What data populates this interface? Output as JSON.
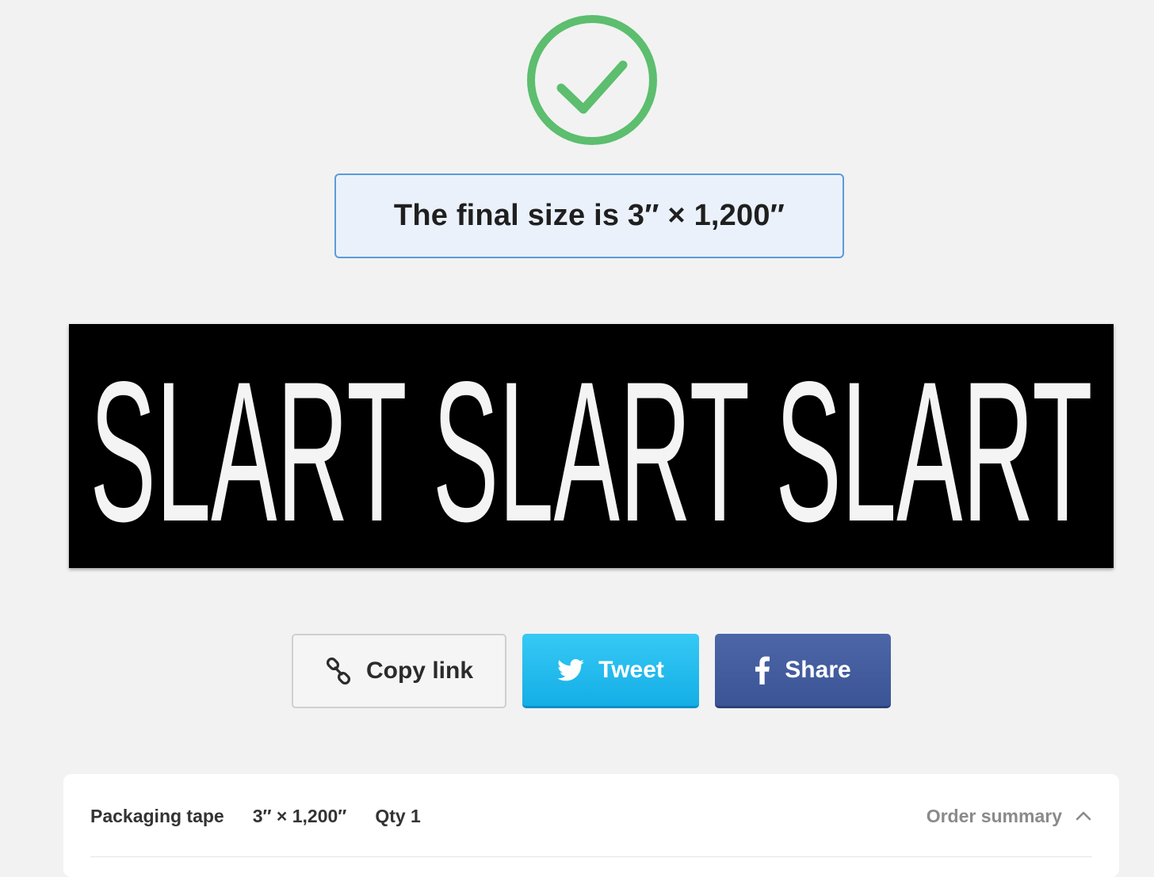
{
  "status": {
    "icon": "check-circle-icon",
    "color": "#5cbe6e"
  },
  "banner": {
    "text": "The final size is 3″ × 1,200″",
    "border_color": "#5b9bd9",
    "background": "#eaf1fb"
  },
  "preview": {
    "text": "SLART SLART SLART",
    "background": "#000000",
    "text_color": "#f4f4f4"
  },
  "share": {
    "copy_label": "Copy link",
    "copy_icon": "link-icon",
    "tweet_label": "Tweet",
    "tweet_icon": "twitter-bird-icon",
    "tweet_color": "#1fb8ec",
    "share_label": "Share",
    "share_icon": "facebook-icon",
    "share_color": "#435ea0"
  },
  "order": {
    "product": "Packaging tape",
    "size": "3″ × 1,200″",
    "qty": "Qty 1",
    "summary_label": "Order summary",
    "summary_icon": "chevron-up-icon"
  }
}
